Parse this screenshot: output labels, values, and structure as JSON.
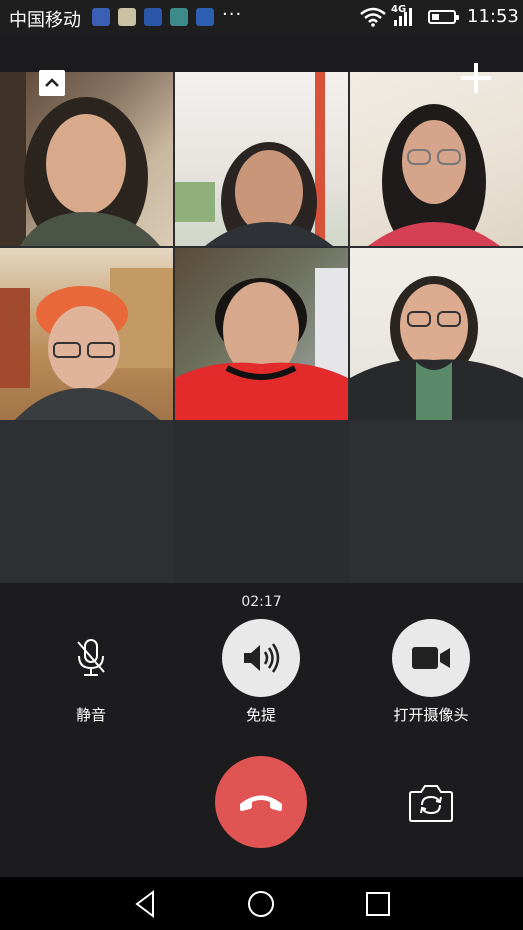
{
  "status_bar": {
    "carrier": "中国移动",
    "more_indicator": "···",
    "network_label": "4G",
    "time": "11:53",
    "notification_icons": [
      "app-notification-icon",
      "app-notification-icon",
      "news-app-icon",
      "gallery-app-icon",
      "app-notification-icon"
    ]
  },
  "call": {
    "duration": "02:17",
    "participants": 6
  },
  "controls": {
    "mute_label": "静音",
    "speaker_label": "免提",
    "camera_label": "打开摄像头"
  },
  "colors": {
    "background": "#1c1c1e",
    "grid_bg": "#2b2c30",
    "hangup": "#e15454",
    "button_fill": "#e9e9e9"
  }
}
